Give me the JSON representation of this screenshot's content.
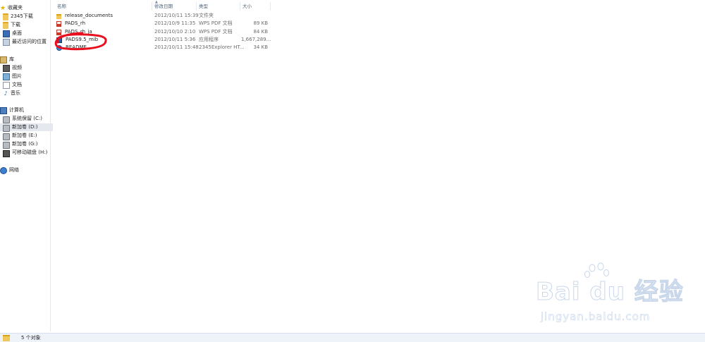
{
  "nav": {
    "favorites": {
      "label": "收藏夹",
      "items": [
        "2345下载",
        "下载",
        "桌面",
        "最近访问的位置"
      ]
    },
    "libraries": {
      "label": "库",
      "items": [
        "视频",
        "图片",
        "文档",
        "音乐"
      ]
    },
    "computer": {
      "label": "计算机",
      "items": [
        "系统保留 (C:)",
        "新加卷 (D:)",
        "新加卷 (E:)",
        "新加卷 (G:)",
        "可移动磁盘 (H:)"
      ],
      "selected": "新加卷 (D:)"
    },
    "network": {
      "label": "网络"
    }
  },
  "columns": {
    "name": "名称",
    "date": "修改日期",
    "type": "类型",
    "size": "大小"
  },
  "files": [
    {
      "name": "release_documents",
      "date": "2012/10/11 15:39",
      "type": "文件夹",
      "size": "",
      "icon": "folder-icon"
    },
    {
      "name": "PADS_rh",
      "date": "2012/10/9 11:35",
      "type": "WPS PDF 文档",
      "size": "89 KB",
      "icon": "pdf-icon"
    },
    {
      "name": "PADS_rh_ja",
      "date": "2012/10/10 2:10",
      "type": "WPS PDF 文档",
      "size": "84 KB",
      "icon": "pdf-icon"
    },
    {
      "name": "PADS9.5_mib",
      "date": "2012/10/11 5:36",
      "type": "应用程序",
      "size": "1,667,289...",
      "icon": "exe-icon"
    },
    {
      "name": "README",
      "date": "2012/10/11 15:48",
      "type": "2345Explorer HT...",
      "size": "34 KB",
      "icon": "html-icon"
    }
  ],
  "status": {
    "count": "5 个对象"
  },
  "watermark": {
    "main": "Bai du 经验",
    "sub": "jingyan.baidu.com"
  },
  "colors": {
    "highlight_circle": "#e8101e",
    "nav_selected": "#e5e9ef",
    "status_bar": "#eef3fa"
  }
}
